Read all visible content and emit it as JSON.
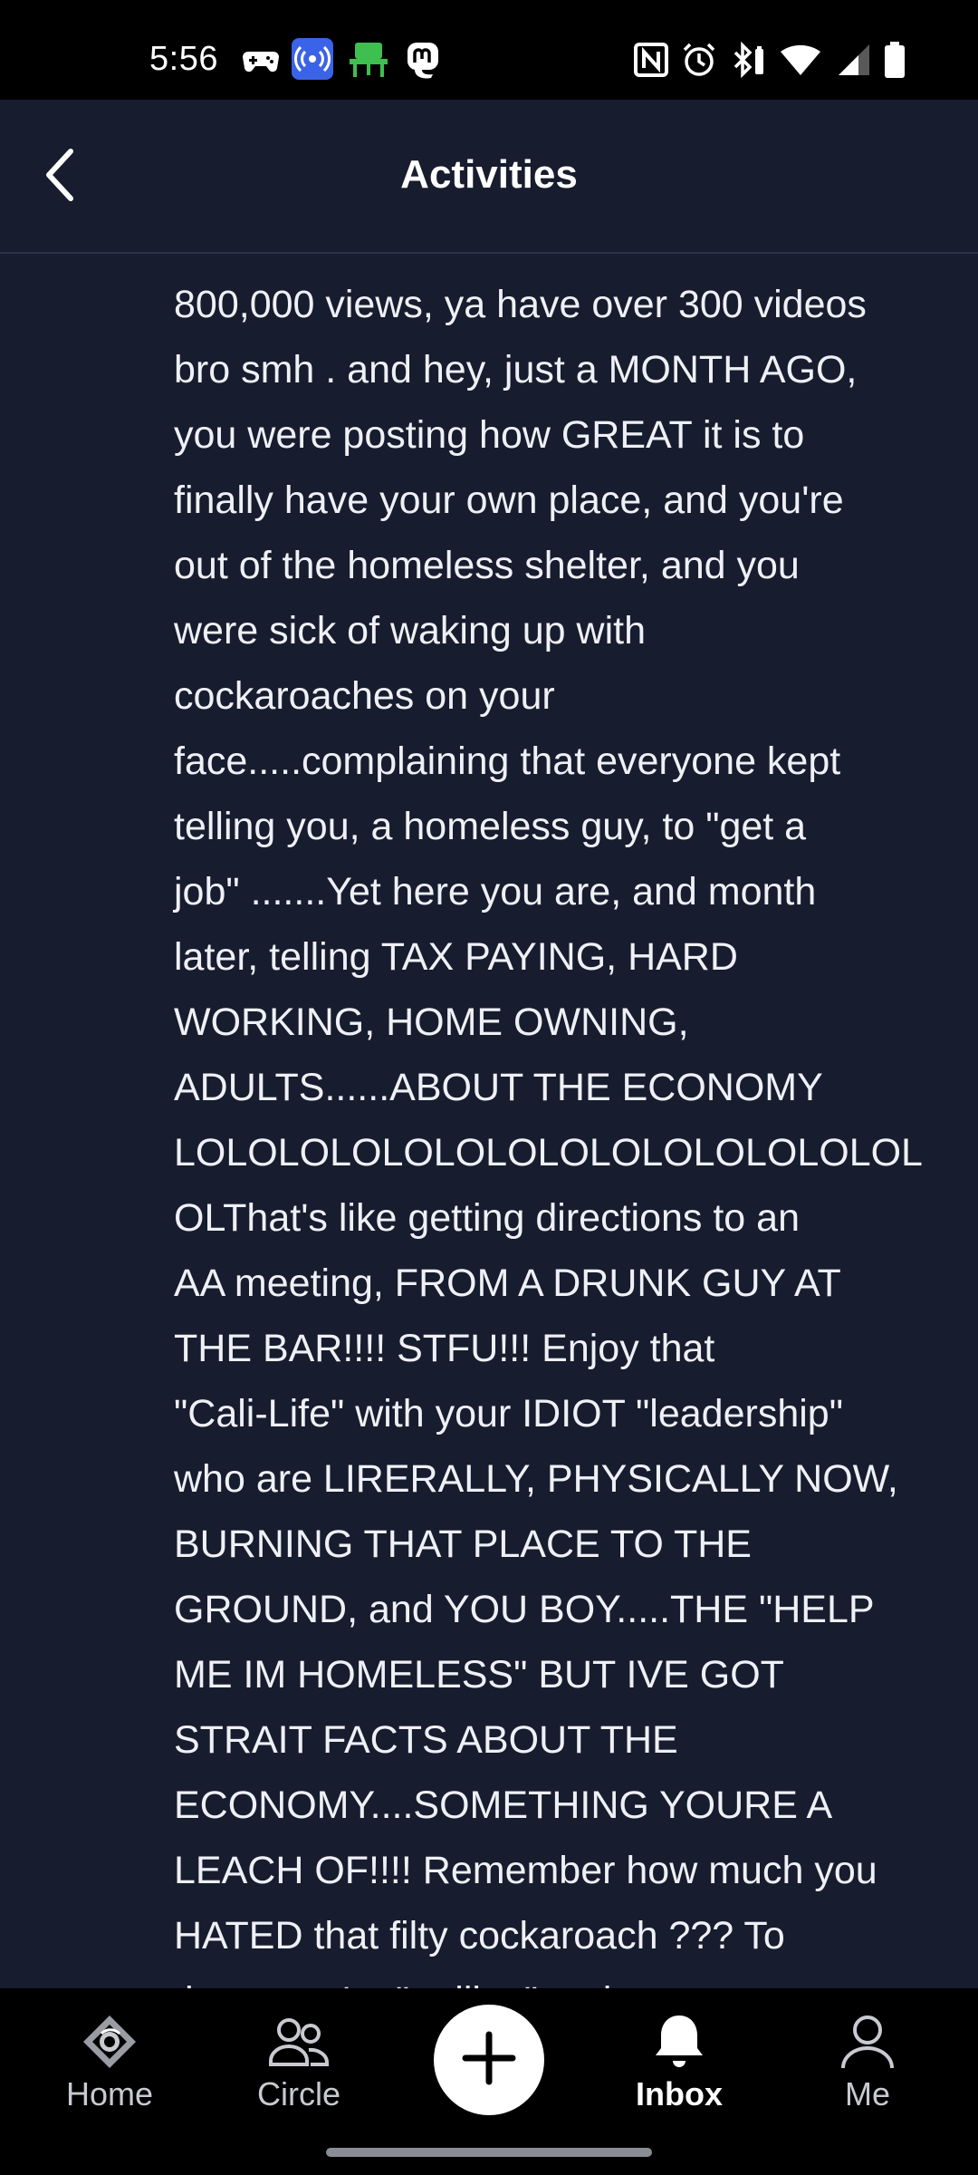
{
  "status_bar": {
    "time": "5:56",
    "left_icons": [
      "gamepad-icon",
      "broadcast-icon",
      "desk-chair-icon",
      "mastodon-icon"
    ],
    "right_icons": [
      "nfc-icon",
      "alarm-icon",
      "bluetooth-battery-icon",
      "wifi-icon",
      "signal-icon",
      "battery-icon"
    ]
  },
  "header": {
    "title": "Activities",
    "back_icon": "chevron-left-icon"
  },
  "comment": {
    "lines": [
      "800,000 views, ya have over 300 videos",
      "bro smh . and hey, just a MONTH AGO,",
      "you were posting how GREAT it is to",
      "finally have your own place, and you're",
      "out of the homeless shelter, and you",
      "were sick of waking up with",
      "cockaroaches on your",
      "face.....complaining that everyone kept",
      "telling you, a homeless guy, to \"get a",
      "job\" .......Yet here you are, and month",
      "later, telling TAX PAYING, HARD",
      "WORKING, HOME OWNING,",
      "ADULTS......ABOUT THE ECONOMY",
      "LOLOLOLOLOLOLOLOLOLOLOLOLOLOL",
      "OLThat's like getting directions to an",
      "AA meeting, FROM A DRUNK GUY AT",
      "THE BAR!!!! STFU!!! Enjoy that",
      "\"Cali-Life\" with your IDIOT \"leadership\"",
      "who are LIRERALLY, PHYSICALLY NOW,",
      "BURNING THAT PLACE TO THE",
      "GROUND, and YOU BOY.....THE \"HELP",
      "ME IM HOMELESS\" BUT IVE GOT",
      "STRAIT FACTS ABOUT THE",
      "ECONOMY....SOMETHING YOURE A",
      "LEACH OF!!!! Remember how much you",
      "HATED that filty cockaroach ??? To",
      "those you're \"trolling\" on here.... to"
    ]
  },
  "bottom_nav": {
    "home": "Home",
    "circle": "Circle",
    "inbox": "Inbox",
    "me": "Me",
    "active": "inbox"
  },
  "colors": {
    "background": "#171c2e",
    "nav_background": "#000000",
    "text": "#eef0f5"
  }
}
